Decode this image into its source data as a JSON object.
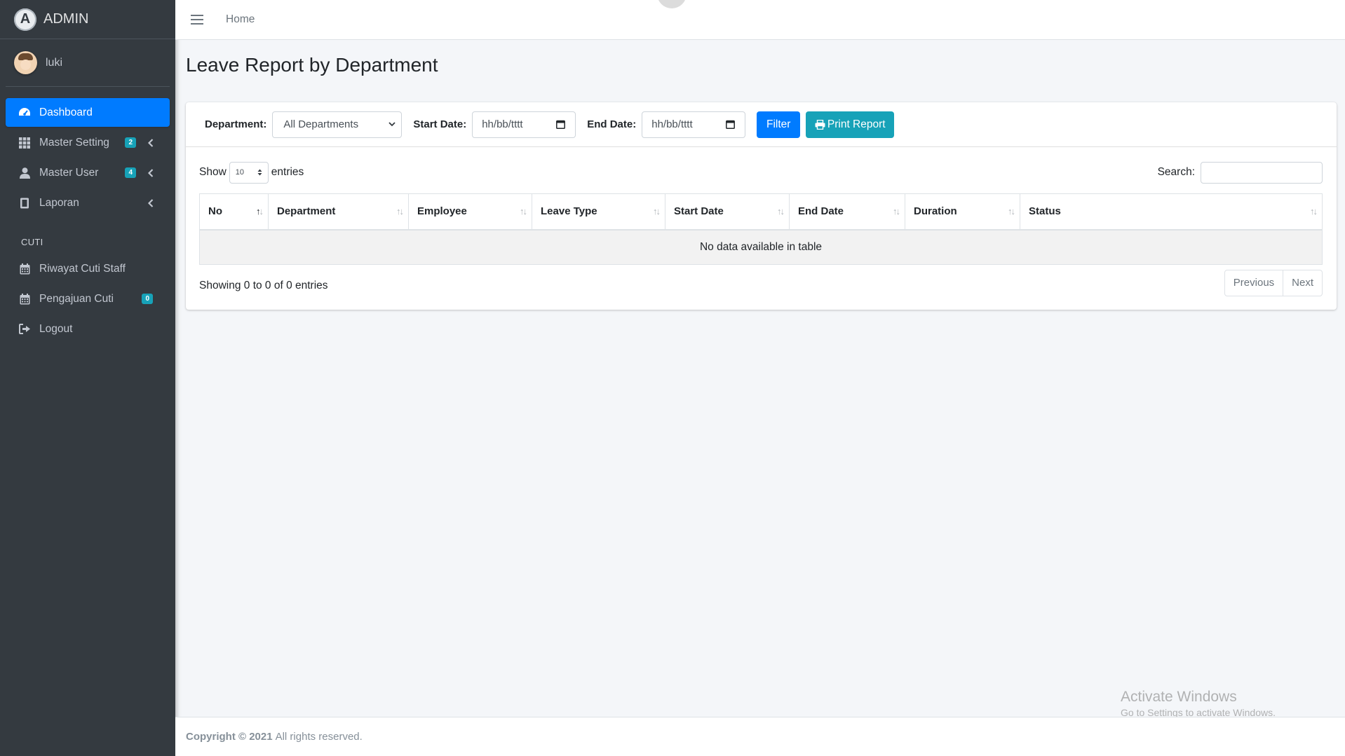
{
  "brand": {
    "title": "ADMIN",
    "logo_letter": "A"
  },
  "user": {
    "name": "luki"
  },
  "sidebar": {
    "items": [
      {
        "label": "Dashboard",
        "icon": "tachometer-icon",
        "active": true
      },
      {
        "label": "Master Setting",
        "icon": "grid-icon",
        "badge": "2"
      },
      {
        "label": "Master User",
        "icon": "user-icon",
        "badge": "4"
      },
      {
        "label": "Laporan",
        "icon": "book-icon"
      }
    ],
    "section_header": "CUTI",
    "section_items": [
      {
        "label": "Riwayat Cuti Staff",
        "icon": "calendar-icon"
      },
      {
        "label": "Pengajuan Cuti",
        "icon": "calendar-icon",
        "badge": "0"
      },
      {
        "label": "Logout",
        "icon": "sign-out-icon"
      }
    ]
  },
  "topbar": {
    "home_label": "Home"
  },
  "page": {
    "title": "Leave Report by Department"
  },
  "filters": {
    "department_label": "Department:",
    "department_value": "All Departments",
    "start_label": "Start Date:",
    "start_placeholder": "hh/bb/tttt",
    "end_label": "End Date:",
    "end_placeholder": "hh/bb/tttt",
    "filter_button": "Filter",
    "print_button": "Print Report"
  },
  "datatable": {
    "show_label": "Show",
    "length_value": "10",
    "entries_label": "entries",
    "search_label": "Search:",
    "columns": [
      "No",
      "Department",
      "Employee",
      "Leave Type",
      "Start Date",
      "End Date",
      "Duration",
      "Status"
    ],
    "empty_message": "No data available in table",
    "info": "Showing 0 to 0 of 0 entries",
    "prev_label": "Previous",
    "next_label": "Next"
  },
  "watermark": {
    "line1": "Activate Windows",
    "line2": "Go to Settings to activate Windows."
  },
  "footer": {
    "copyright": "Copyright © 2021",
    "rights": "All rights reserved."
  },
  "colors": {
    "sidebar_bg": "#343a40",
    "primary": "#007bff",
    "info": "#17a2b8",
    "content_bg": "#f4f6f9"
  }
}
